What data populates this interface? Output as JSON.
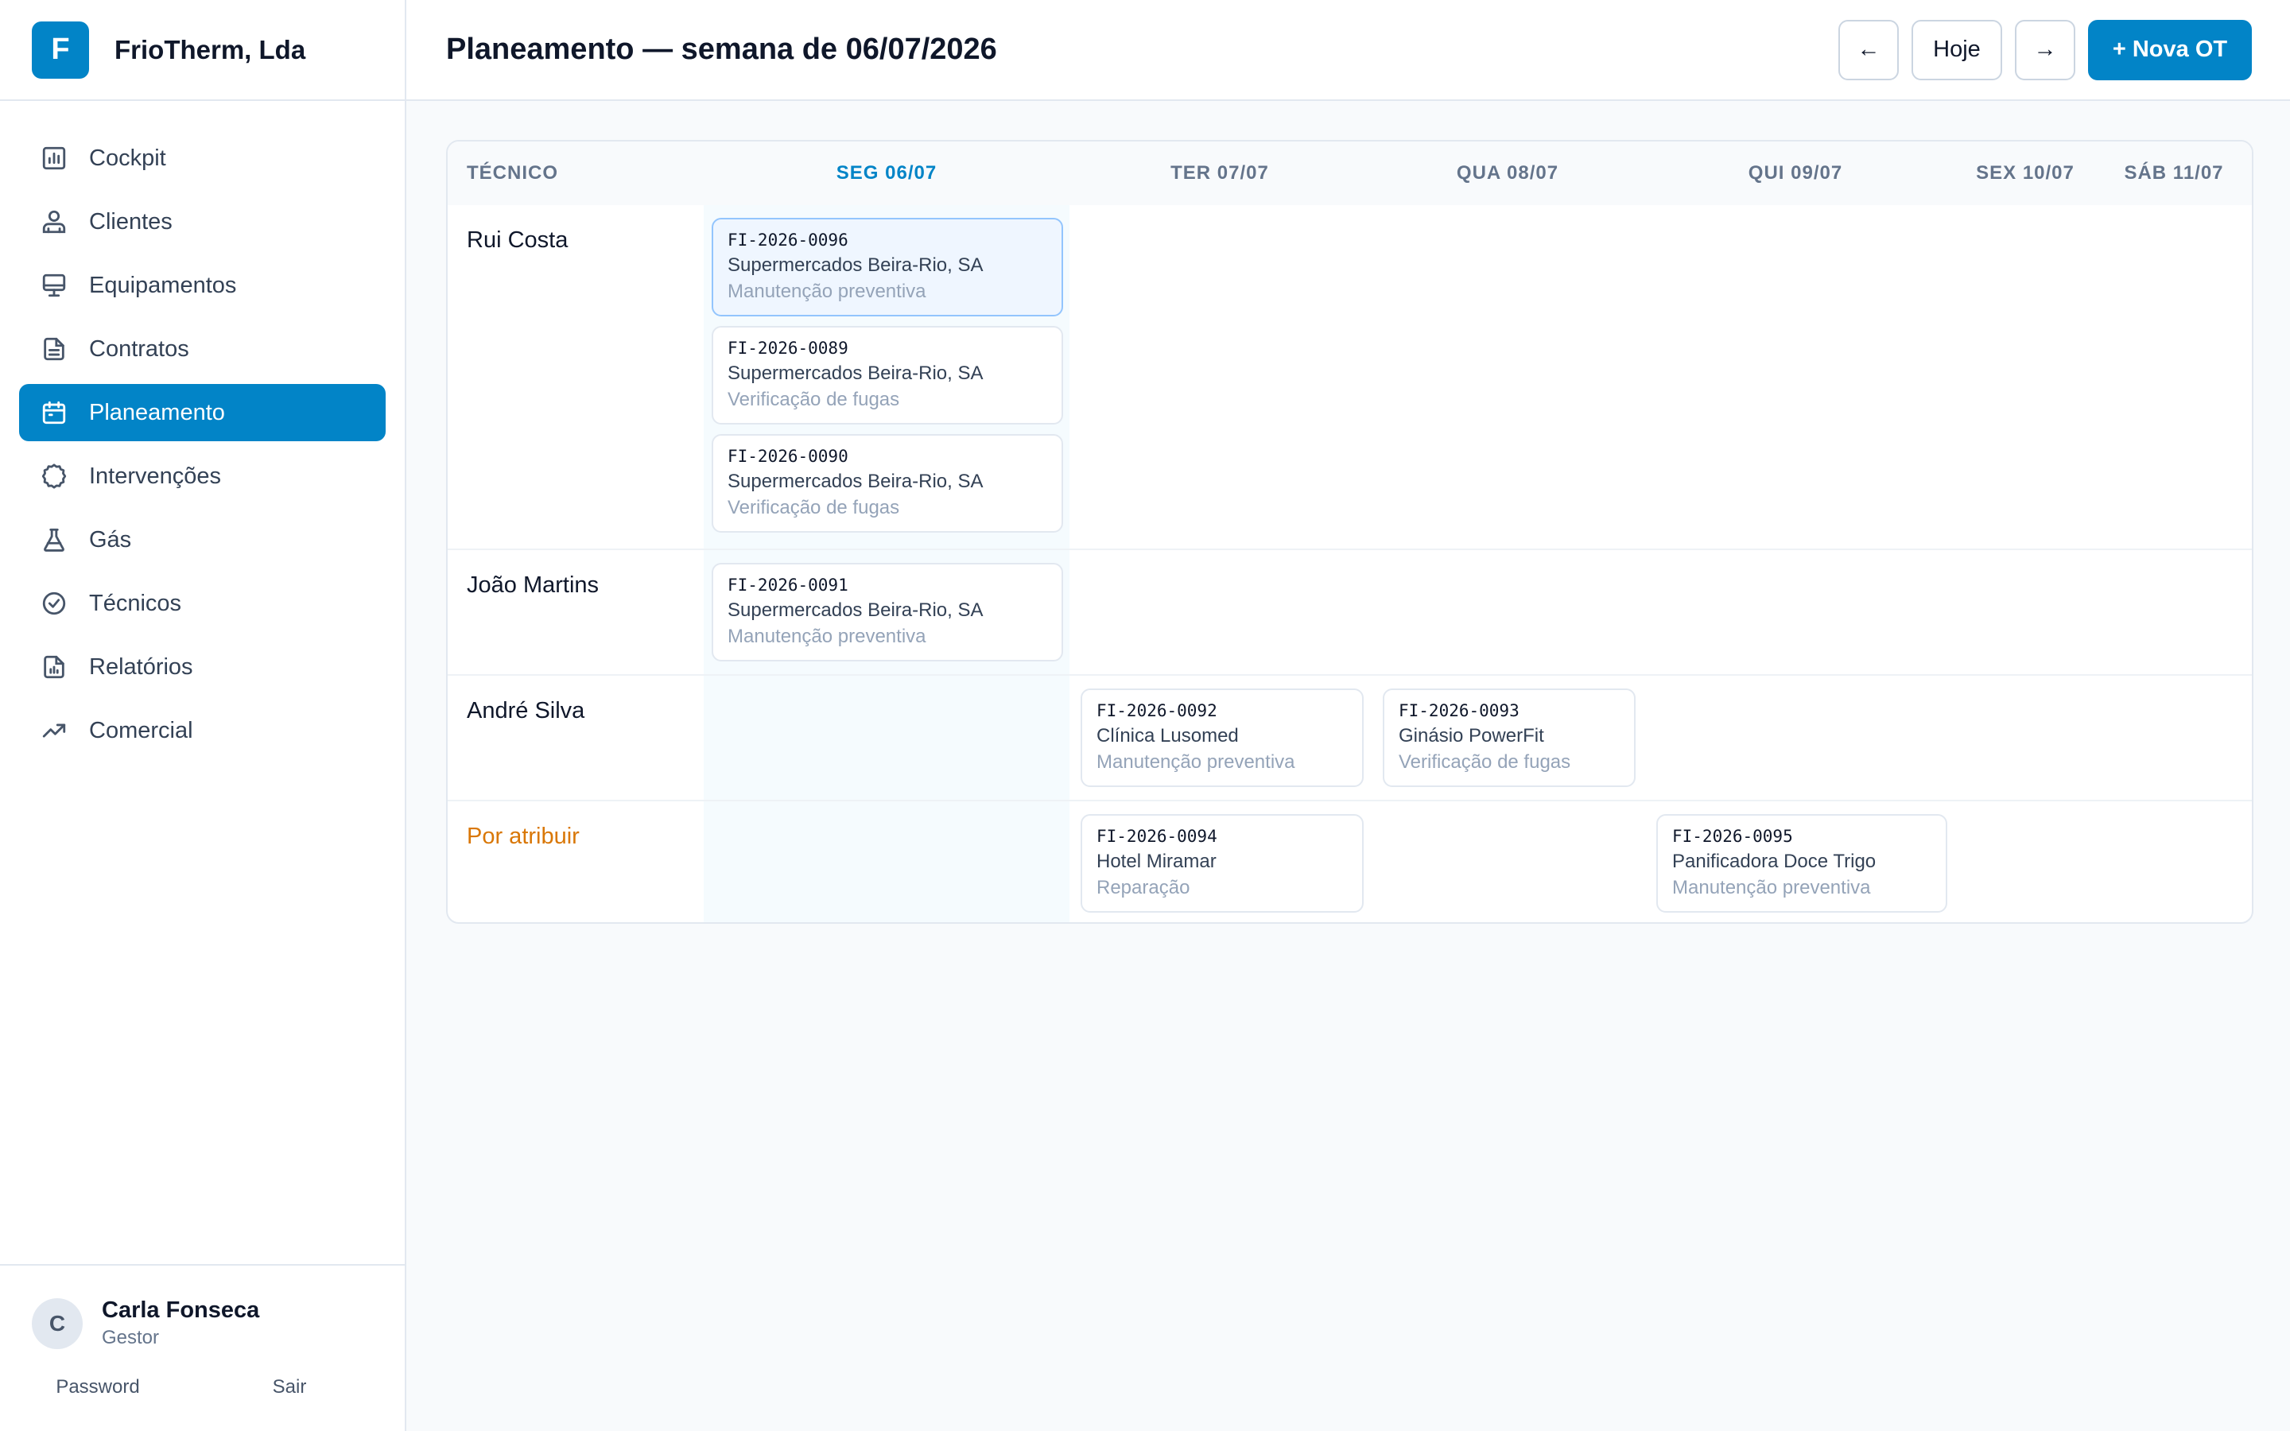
{
  "brand": {
    "logo_letter": "F",
    "name": "FrioTherm, Lda"
  },
  "nav": [
    {
      "label": "Cockpit",
      "icon": "chart-icon"
    },
    {
      "label": "Clientes",
      "icon": "users-icon"
    },
    {
      "label": "Equipamentos",
      "icon": "monitor-icon"
    },
    {
      "label": "Contratos",
      "icon": "document-icon"
    },
    {
      "label": "Planeamento",
      "icon": "calendar-icon",
      "active": true
    },
    {
      "label": "Intervenções",
      "icon": "gear-icon"
    },
    {
      "label": "Gás",
      "icon": "flask-icon"
    },
    {
      "label": "Técnicos",
      "icon": "check-circle-icon"
    },
    {
      "label": "Relatórios",
      "icon": "report-icon"
    },
    {
      "label": "Comercial",
      "icon": "trending-icon"
    }
  ],
  "user": {
    "initial": "C",
    "name": "Carla Fonseca",
    "role": "Gestor",
    "password_link": "Password",
    "logout_link": "Sair"
  },
  "header": {
    "title": "Planeamento — semana de 06/07/2026",
    "prev_label": "←",
    "today_label": "Hoje",
    "next_label": "→",
    "new_label": "+ Nova OT"
  },
  "columns": {
    "tech": "TÉCNICO",
    "days": [
      "SEG 06/07",
      "TER 07/07",
      "QUA 08/07",
      "QUI 09/07",
      "SEX 10/07",
      "SÁB 11/07"
    ]
  },
  "rows": [
    {
      "name": "Rui Costa",
      "cards": [
        {
          "code": "FI-2026-0096",
          "client": "Supermercados Beira-Rio, SA",
          "type": "Manutenção preventiva"
        },
        {
          "code": "FI-2026-0089",
          "client": "Supermercados Beira-Rio, SA",
          "type": "Verificação de fugas"
        },
        {
          "code": "FI-2026-0090",
          "client": "Supermercados Beira-Rio, SA",
          "type": "Verificação de fugas"
        }
      ]
    },
    {
      "name": "João Martins",
      "cards": [
        {
          "code": "FI-2026-0091",
          "client": "Supermercados Beira-Rio, SA",
          "type": "Manutenção preventiva"
        }
      ]
    },
    {
      "name": "André Silva",
      "cards": [
        {
          "code": "FI-2026-0092",
          "client": "Clínica Lusomed",
          "type": "Manutenção preventiva"
        },
        {
          "code": "FI-2026-0093",
          "client": "Ginásio PowerFit",
          "type": "Verificação de fugas"
        }
      ]
    },
    {
      "name": "Por atribuir",
      "cards": [
        {
          "code": "FI-2026-0094",
          "client": "Hotel Miramar",
          "type": "Reparação"
        },
        {
          "code": "FI-2026-0095",
          "client": "Panificadora Doce Trigo",
          "type": "Manutenção preventiva"
        }
      ]
    }
  ],
  "colors": {
    "accent": "#0284c7",
    "unassigned": "#d97706",
    "highlight_bg": "#eff6ff"
  }
}
